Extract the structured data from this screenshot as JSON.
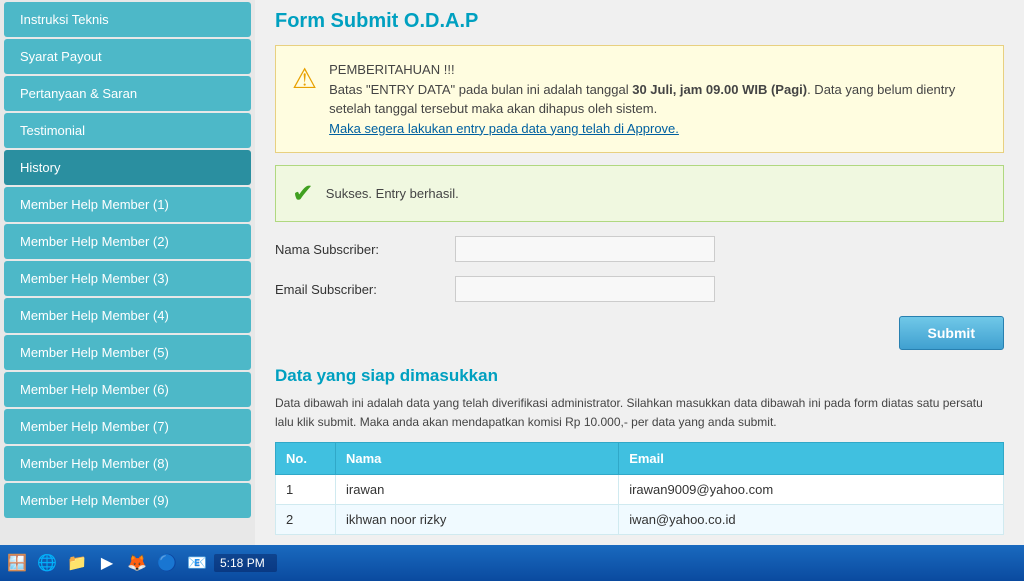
{
  "page": {
    "title": "Form Submit O.D.A.P"
  },
  "sidebar": {
    "items": [
      {
        "id": "instruksi-teknis",
        "label": "Instruksi Teknis",
        "active": false
      },
      {
        "id": "syarat-payout",
        "label": "Syarat Payout",
        "active": false
      },
      {
        "id": "pertanyaan-saran",
        "label": "Pertanyaan & Saran",
        "active": false
      },
      {
        "id": "testimonial",
        "label": "Testimonial",
        "active": false
      },
      {
        "id": "history",
        "label": "History",
        "active": true
      },
      {
        "id": "member-help-1",
        "label": "Member Help Member (1)",
        "active": false
      },
      {
        "id": "member-help-2",
        "label": "Member Help Member (2)",
        "active": false
      },
      {
        "id": "member-help-3",
        "label": "Member Help Member (3)",
        "active": false
      },
      {
        "id": "member-help-4",
        "label": "Member Help Member (4)",
        "active": false
      },
      {
        "id": "member-help-5",
        "label": "Member Help Member (5)",
        "active": false
      },
      {
        "id": "member-help-6",
        "label": "Member Help Member (6)",
        "active": false
      },
      {
        "id": "member-help-7",
        "label": "Member Help Member (7)",
        "active": false
      },
      {
        "id": "member-help-8",
        "label": "Member Help Member (8)",
        "active": false
      },
      {
        "id": "member-help-9",
        "label": "Member Help Member (9)",
        "active": false
      }
    ]
  },
  "notice": {
    "title": "PEMBERITAHUAN !!!",
    "line1_prefix": "Batas \"ENTRY DATA\" pada bulan ini adalah tanggal ",
    "line1_bold": "30 Juli, jam 09.00 WIB (Pagi)",
    "line1_suffix": ". Data yang belum dientry setelah tanggal tersebut maka akan dihapus oleh sistem.",
    "line2": "Maka segera lakukan entry pada data yang telah di Approve."
  },
  "success": {
    "message": "Sukses. Entry berhasil."
  },
  "form": {
    "nama_label": "Nama Subscriber:",
    "email_label": "Email Subscriber:",
    "nama_placeholder": "",
    "email_placeholder": "",
    "submit_label": "Submit"
  },
  "data_section": {
    "title": "Data yang siap dimasukkan",
    "description": "Data dibawah ini adalah data yang telah diverifikasi administrator. Silahkan masukkan data dibawah ini pada form diatas satu persatu lalu klik submit. Maka anda akan mendapatkan komisi Rp 10.000,- per data yang anda submit."
  },
  "table": {
    "headers": [
      "No.",
      "Nama",
      "Email"
    ],
    "rows": [
      {
        "no": "1",
        "nama": "irawan",
        "email": "irawan9009@yahoo.com"
      },
      {
        "no": "2",
        "nama": "ikhwan noor rizky",
        "email": "iwan@yahoo.co.id"
      }
    ]
  },
  "taskbar": {
    "time": "5:18 PM"
  }
}
